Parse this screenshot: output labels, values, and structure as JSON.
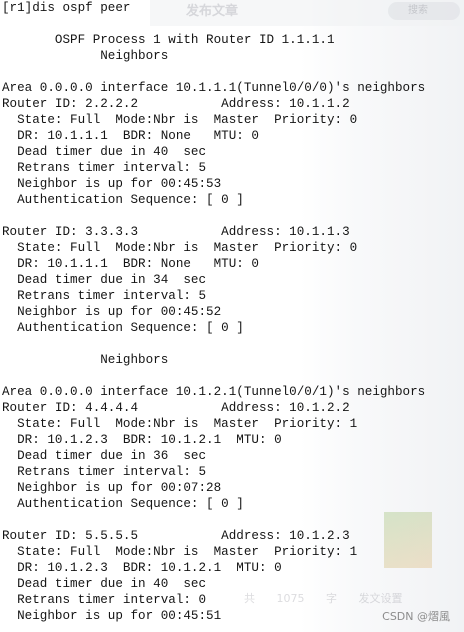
{
  "background": {
    "title": "发布文章",
    "search_placeholder": "搜索",
    "bottom_text": "共 1075 字 发文设置"
  },
  "terminal": {
    "lines": [
      "[r1]dis ospf peer",
      "",
      "       OSPF Process 1 with Router ID 1.1.1.1",
      "             Neighbors",
      "",
      "Area 0.0.0.0 interface 10.1.1.1(Tunnel0/0/0)'s neighbors",
      "Router ID: 2.2.2.2           Address: 10.1.1.2",
      "  State: Full  Mode:Nbr is  Master  Priority: 0",
      "  DR: 10.1.1.1  BDR: None   MTU: 0",
      "  Dead timer due in 40  sec",
      "  Retrans timer interval: 5",
      "  Neighbor is up for 00:45:53",
      "  Authentication Sequence: [ 0 ]",
      "",
      "Router ID: 3.3.3.3           Address: 10.1.1.3",
      "  State: Full  Mode:Nbr is  Master  Priority: 0",
      "  DR: 10.1.1.1  BDR: None   MTU: 0",
      "  Dead timer due in 34  sec",
      "  Retrans timer interval: 5",
      "  Neighbor is up for 00:45:52",
      "  Authentication Sequence: [ 0 ]",
      "",
      "             Neighbors",
      "",
      "Area 0.0.0.0 interface 10.1.2.1(Tunnel0/0/1)'s neighbors",
      "Router ID: 4.4.4.4           Address: 10.1.2.2",
      "  State: Full  Mode:Nbr is  Master  Priority: 1",
      "  DR: 10.1.2.3  BDR: 10.1.2.1  MTU: 0",
      "  Dead timer due in 36  sec",
      "  Retrans timer interval: 5",
      "  Neighbor is up for 00:07:28",
      "  Authentication Sequence: [ 0 ]",
      "",
      "Router ID: 5.5.5.5           Address: 10.1.2.3",
      "  State: Full  Mode:Nbr is  Master  Priority: 1",
      "  DR: 10.1.2.3  BDR: 10.1.2.1  MTU: 0",
      "  Dead timer due in 40  sec",
      "  Retrans timer interval: 0",
      "  Neighbor is up for 00:45:51"
    ]
  },
  "watermark": "CSDN @熠風"
}
